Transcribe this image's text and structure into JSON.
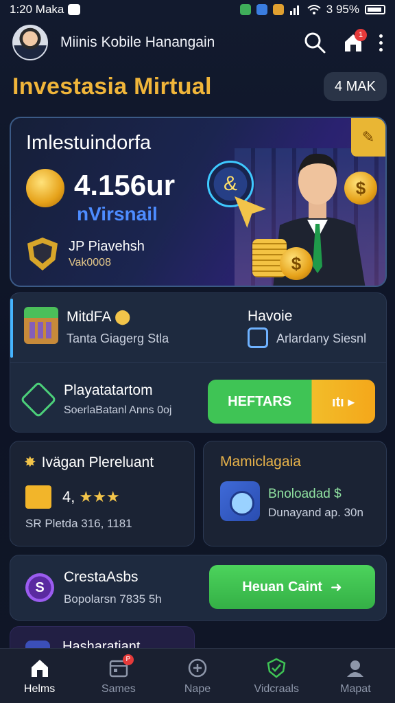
{
  "status_bar": {
    "time_left": "1:20 Maka",
    "battery_text": "3 95%"
  },
  "header": {
    "app_title": "Miinis Kobile Hanangain",
    "notification_count": "1"
  },
  "title_row": {
    "page_title": "Investasia Mirtual",
    "chip_label": "4 MAK"
  },
  "hero": {
    "heading": "Imlestuindorfa",
    "amount": "4.156ur",
    "sub": "nVirsnail",
    "shield_label": "JP Piavehsh",
    "shield_value": "Vak0008",
    "ring_glyph": "&",
    "coin_glyph": "$"
  },
  "combo_card": {
    "left_title": "MitdFA",
    "left_sub": "Tanta Giagerg Stla",
    "right_title": "Havoie",
    "right_sub": "Arlardany Siesnl",
    "bottom_title": "Playatatartom",
    "bottom_sub": "SoerlaBatanl Anns 0oj",
    "button_label": "HEFTARS",
    "button_badge": "ıtı ▸"
  },
  "left_card": {
    "title": "Ivägan Plereluant",
    "rating_value": "4,",
    "stars": "★★★",
    "meta": "SR Pletda 316, 1181"
  },
  "right_card": {
    "title": "Mamiclagaia",
    "line1": "Bnoloadad $",
    "line2": "Dunayand ap. 30n"
  },
  "cta_card": {
    "coin_glyph": "S",
    "title": "CrestaAsbs",
    "sub": "Bopolarsn 7835 5h",
    "button_label": "Heuan Caint",
    "button_arrow": "➜"
  },
  "peek_card": {
    "title": "Hasharatiant"
  },
  "bottom_nav": {
    "items": [
      {
        "label": "Helms",
        "icon": "home-icon"
      },
      {
        "label": "Sames",
        "icon": "calendar-icon",
        "badge": "P"
      },
      {
        "label": "Nape",
        "icon": "compass-icon"
      },
      {
        "label": "Vidcraals",
        "icon": "check-shield-icon"
      },
      {
        "label": "Mapat",
        "icon": "profile-icon"
      }
    ]
  },
  "colors": {
    "accent_gold": "#f0b53a",
    "accent_green": "#3fc455",
    "accent_blue": "#4d8cff",
    "background": "#0f1424"
  }
}
